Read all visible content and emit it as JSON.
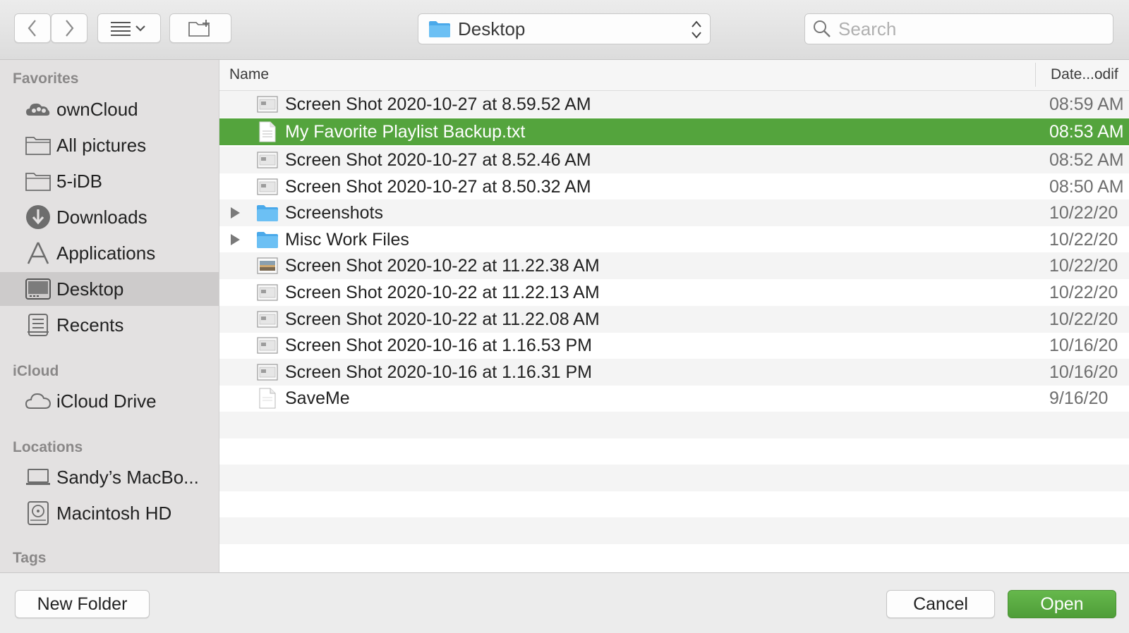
{
  "toolbar": {
    "back_icon": "chevron-left-icon",
    "forward_icon": "chevron-right-icon",
    "view_icon": "list-view-icon",
    "new_folder_icon": "folder-plus-icon",
    "location": "Desktop",
    "search_placeholder": "Search"
  },
  "sidebar": {
    "sections": [
      {
        "title": "Favorites",
        "items": [
          {
            "label": "ownCloud",
            "icon": "cloud-people-icon"
          },
          {
            "label": "All pictures",
            "icon": "folder-icon"
          },
          {
            "label": "5-iDB",
            "icon": "folder-icon"
          },
          {
            "label": "Downloads",
            "icon": "download-icon"
          },
          {
            "label": "Applications",
            "icon": "applications-icon"
          },
          {
            "label": "Desktop",
            "icon": "desktop-icon",
            "selected": true
          },
          {
            "label": "Recents",
            "icon": "recents-icon"
          }
        ]
      },
      {
        "title": "iCloud",
        "items": [
          {
            "label": "iCloud Drive",
            "icon": "cloud-icon"
          }
        ]
      },
      {
        "title": "Locations",
        "items": [
          {
            "label": "Sandy’s MacBo...",
            "icon": "laptop-icon"
          },
          {
            "label": "Macintosh HD",
            "icon": "hard-drive-icon"
          }
        ]
      },
      {
        "title": "Tags",
        "items": []
      }
    ]
  },
  "list": {
    "columns": {
      "name": "Name",
      "date": "Date...odif"
    },
    "rows": [
      {
        "name": "Screen Shot 2020-10-27 at 8.59.52 AM",
        "date": "08:59 AM",
        "type": "image"
      },
      {
        "name": "My Favorite Playlist Backup.txt",
        "date": "08:53 AM",
        "type": "text",
        "selected": true
      },
      {
        "name": "Screen Shot 2020-10-27 at 8.52.46 AM",
        "date": "08:52 AM",
        "type": "image"
      },
      {
        "name": "Screen Shot 2020-10-27 at 8.50.32 AM",
        "date": "08:50 AM",
        "type": "image"
      },
      {
        "name": "Screenshots",
        "date": "10/22/20",
        "type": "folder"
      },
      {
        "name": "Misc Work Files",
        "date": "10/22/20",
        "type": "folder"
      },
      {
        "name": "Screen Shot 2020-10-22 at 11.22.38 AM",
        "date": "10/22/20",
        "type": "photo"
      },
      {
        "name": "Screen Shot 2020-10-22 at 11.22.13 AM",
        "date": "10/22/20",
        "type": "image"
      },
      {
        "name": "Screen Shot 2020-10-22 at 11.22.08 AM",
        "date": "10/22/20",
        "type": "image"
      },
      {
        "name": "Screen Shot 2020-10-16 at 1.16.53 PM",
        "date": "10/16/20",
        "type": "image"
      },
      {
        "name": "Screen Shot 2020-10-16 at 1.16.31 PM",
        "date": "10/16/20",
        "type": "image"
      },
      {
        "name": "SaveMe",
        "date": "9/16/20",
        "type": "doc"
      }
    ]
  },
  "buttons": {
    "new_folder": "New Folder",
    "cancel": "Cancel",
    "open": "Open"
  },
  "colors": {
    "selection": "#54a43d",
    "folder_blue": "#58b4ee",
    "primary_button": "#56a53f"
  }
}
